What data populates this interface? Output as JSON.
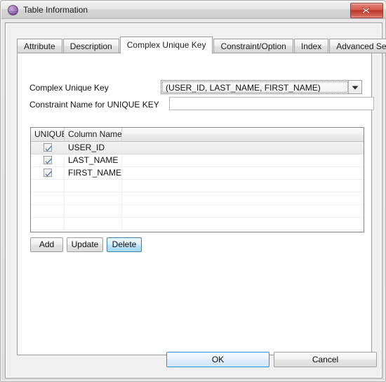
{
  "window": {
    "title": "Table Information",
    "icon": "sphere-icon",
    "close_label": "x",
    "accent_blue": "#3c7fb1",
    "close_red": "#bf3527",
    "icon_purple": "#9b6fb5"
  },
  "tabs": [
    {
      "label": "Attribute",
      "active": false
    },
    {
      "label": "Description",
      "active": false
    },
    {
      "label": "Complex Unique Key",
      "active": true
    },
    {
      "label": "Constraint/Option",
      "active": false
    },
    {
      "label": "Index",
      "active": false
    },
    {
      "label": "Advanced Settings",
      "active": false
    }
  ],
  "form": {
    "complex_unique_key_label": "Complex Unique Key",
    "complex_unique_key_value": "(USER_ID, LAST_NAME, FIRST_NAME)",
    "constraint_name_label": "Constraint Name for UNIQUE KEY",
    "constraint_name_value": "",
    "constraint_name_placeholder": ""
  },
  "grid": {
    "columns": [
      "UNIQUE",
      "Column Name",
      ""
    ],
    "rows": [
      {
        "unique": true,
        "column_name": "USER_ID",
        "extra": "",
        "selected": true
      },
      {
        "unique": true,
        "column_name": "LAST_NAME",
        "extra": "",
        "selected": false
      },
      {
        "unique": true,
        "column_name": "FIRST_NAME",
        "extra": "",
        "selected": false
      }
    ],
    "empty_rows": 4
  },
  "actions": {
    "add_label": "Add",
    "update_label": "Update",
    "delete_label": "Delete"
  },
  "footer": {
    "ok_label": "OK",
    "cancel_label": "Cancel"
  }
}
